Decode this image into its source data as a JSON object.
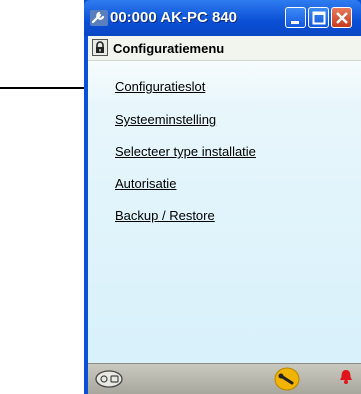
{
  "window": {
    "title": "00:000 AK-PC 840",
    "icons": {
      "app": "wrench-app-icon",
      "minimize": "minimize-icon",
      "maximize": "maximize-icon",
      "close": "close-icon"
    }
  },
  "header": {
    "title": "Configuratiemenu",
    "icon": "lock-icon"
  },
  "menu": [
    {
      "label": "Configuratieslot"
    },
    {
      "label": "Systeeminstelling"
    },
    {
      "label": "Selecteer type installatie"
    },
    {
      "label": "Autorisatie"
    },
    {
      "label": "Backup / Restore"
    }
  ],
  "statusbar": {
    "icons": [
      "controller-icon",
      "service-wrench-icon",
      "alarm-bell-icon"
    ]
  },
  "colors": {
    "titlebar": "#0a50d8",
    "close": "#c63a1d",
    "client": "#d6f0fb",
    "statusbar": "#b3b3aa"
  }
}
